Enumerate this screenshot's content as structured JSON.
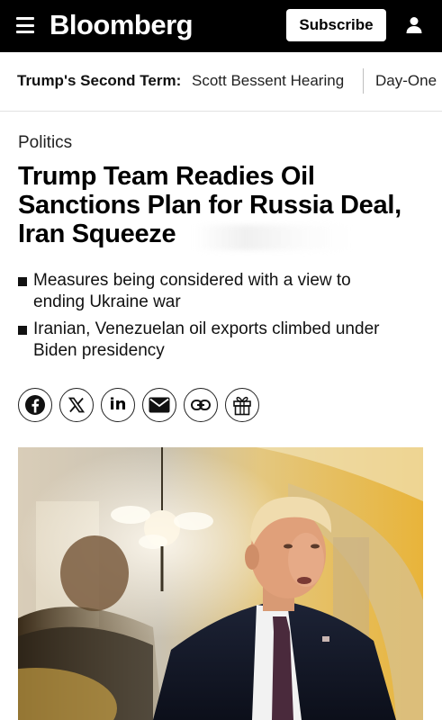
{
  "header": {
    "logo": "Bloomberg",
    "subscribe_label": "Subscribe"
  },
  "ticker": {
    "label": "Trump's Second Term:",
    "links": [
      "Scott Bessent Hearing",
      "Day-One"
    ]
  },
  "article": {
    "section": "Politics",
    "headline_line1": "Trump Team Readies Oil",
    "headline_line2": "Sanctions Plan for Russia Deal,",
    "headline_line3": "Iran Squeeze",
    "bullets": [
      {
        "line1": "Measures being considered with a view to",
        "line2": "ending Ukraine war"
      },
      {
        "line1": "Iranian, Venezuelan oil exports climbed under",
        "line2": "Biden presidency"
      }
    ]
  },
  "share": {
    "icons": [
      "facebook-icon",
      "x-icon",
      "linkedin-icon",
      "email-icon",
      "link-icon",
      "gift-icon"
    ],
    "linkedin_text": "in"
  },
  "colors": {
    "topbar_bg": "#000000",
    "text": "#111111",
    "photo_warm": "#e9b94a"
  }
}
